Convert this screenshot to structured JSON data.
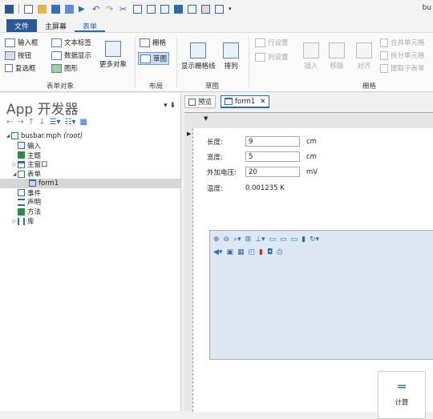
{
  "window_title": "bu",
  "ribbon_tabs": [
    "文件",
    "主屏幕",
    "表单"
  ],
  "ribbon": {
    "form_objects": {
      "input_field": "输入框",
      "text_label": "文本标签",
      "button": "按钮",
      "data_display": "数据显示",
      "checkbox": "复选框",
      "graph": "图形",
      "more_objects": "更多对象",
      "group_label": "表单对象"
    },
    "layout": {
      "grid": "栅格",
      "sketch": "草图",
      "group_label": "布局"
    },
    "sketch": {
      "show_grid": "显示栅格线",
      "arrange": "排列",
      "group_label": "草图"
    },
    "grid": {
      "row_settings": "行设置",
      "col_settings": "列设置",
      "insert": "插入",
      "remove": "移除",
      "align": "对齐",
      "merge_cells": "合并单元格",
      "split_cells": "拆分单元格",
      "extract_subform": "提取子表单",
      "group_label": "栅格"
    }
  },
  "builder": {
    "title": "App 开发器",
    "pin": "▾ ⬇",
    "tree": [
      {
        "label": "busbar.mph",
        "suffix": "(root)",
        "level": 0,
        "expanded": true
      },
      {
        "label": "输入",
        "level": 1
      },
      {
        "label": "主题",
        "level": 1
      },
      {
        "label": "主窗口",
        "level": 1,
        "collapsed": true
      },
      {
        "label": "表单",
        "level": 1,
        "expanded": true
      },
      {
        "label": "form1",
        "level": 2,
        "selected": true
      },
      {
        "label": "事件",
        "level": 1
      },
      {
        "label": "声明",
        "level": 1
      },
      {
        "label": "方法",
        "level": 1
      },
      {
        "label": "库",
        "level": 1,
        "collapsed": true
      }
    ]
  },
  "doc_tabs": {
    "preview": "预览",
    "form1": "form1"
  },
  "form": {
    "length_label": "长度:",
    "length_value": "9",
    "length_unit": "cm",
    "width_label": "宽度:",
    "width_value": "5",
    "width_unit": "cm",
    "voltage_label": "外加电压:",
    "voltage_value": "20",
    "voltage_unit": "mV",
    "temp_label": "温度:",
    "temp_value": "0.001235 K",
    "calc_label": "计算"
  },
  "colors": {
    "accent": "#2a6ab3",
    "file_tab": "#2b5797",
    "graph_bg": "#dde8f3"
  }
}
